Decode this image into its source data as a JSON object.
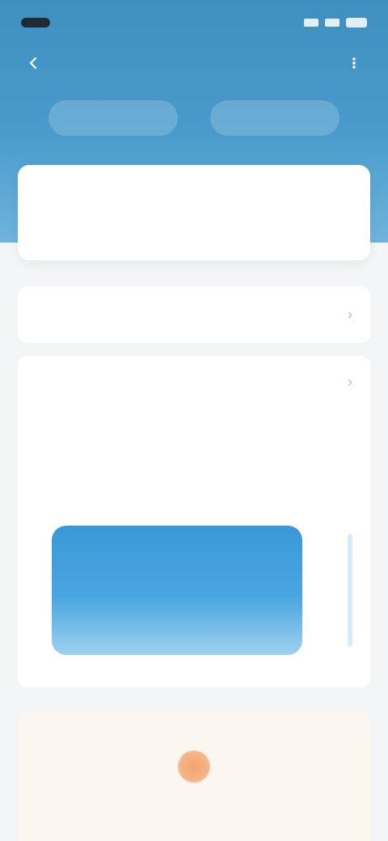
{
  "status_bar": {
    "time": "",
    "signal": "signal-icon",
    "wifi": "wifi-icon",
    "battery": "battery-icon"
  },
  "nav": {
    "back_icon": "back-icon",
    "title": "",
    "action_icon": "more-icon"
  },
  "tabs": [
    {
      "label": ""
    },
    {
      "label": ""
    }
  ],
  "stats": [
    {
      "value": "",
      "label": ""
    },
    {
      "value": "",
      "label": ""
    },
    {
      "value": "",
      "label": ""
    }
  ],
  "rows": [
    {
      "title": ""
    }
  ],
  "panel": {
    "title": "",
    "subtitle": "",
    "note": ""
  },
  "bottom": {
    "text": ""
  },
  "colors": {
    "primary": "#4a9bcb",
    "accent": "#3b98d8",
    "warm": "#f6a26b"
  }
}
